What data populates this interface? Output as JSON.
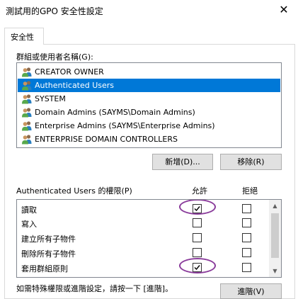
{
  "window": {
    "title": "測試用的GPO 安全性設定",
    "close_glyph": "✕"
  },
  "tab": {
    "label": "安全性"
  },
  "groups": {
    "label": "群組或使用者名稱(G):",
    "items": [
      {
        "label": "CREATOR OWNER",
        "selected": false,
        "icon": "users-icon"
      },
      {
        "label": "Authenticated Users",
        "selected": true,
        "icon": "users-icon"
      },
      {
        "label": "SYSTEM",
        "selected": false,
        "icon": "users-icon"
      },
      {
        "label": "Domain Admins (SAYMS\\Domain Admins)",
        "selected": false,
        "icon": "users-icon"
      },
      {
        "label": "Enterprise Admins (SAYMS\\Enterprise Admins)",
        "selected": false,
        "icon": "users-icon"
      },
      {
        "label": "ENTERPRISE DOMAIN CONTROLLERS",
        "selected": false,
        "icon": "users-icon"
      }
    ],
    "add_button": "新增(D)...",
    "remove_button": "移除(R)"
  },
  "permissions": {
    "label": "Authenticated Users 的權限(P)",
    "allow_header": "允許",
    "deny_header": "拒絕",
    "rows": [
      {
        "name": "讀取",
        "allow": true,
        "deny": false,
        "highlighted": true
      },
      {
        "name": "寫入",
        "allow": false,
        "deny": false,
        "highlighted": false
      },
      {
        "name": "建立所有子物件",
        "allow": false,
        "deny": false,
        "highlighted": false
      },
      {
        "name": "刪除所有子物件",
        "allow": false,
        "deny": false,
        "highlighted": false
      },
      {
        "name": "套用群組原則",
        "allow": true,
        "deny": false,
        "highlighted": true
      }
    ],
    "highlight_color": "#8a3c9b"
  },
  "footer": {
    "hint": "如需特殊權限或進階設定，請按一下 [進階]。",
    "advanced_button": "進階(V)"
  },
  "colors": {
    "selection": "#0078d7",
    "button_face": "#e1e1e1"
  }
}
